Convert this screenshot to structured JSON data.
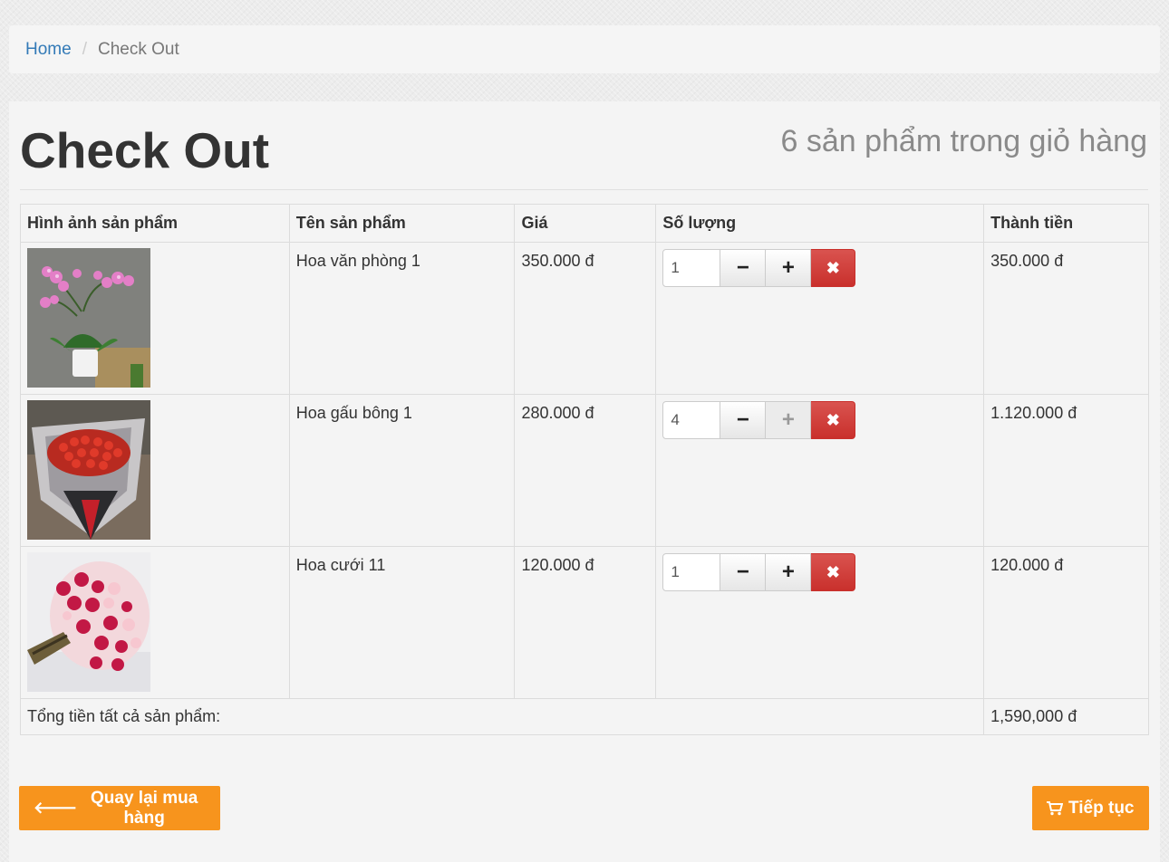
{
  "breadcrumb": {
    "home": "Home",
    "separator": "/",
    "current": "Check Out"
  },
  "page": {
    "title": "Check Out",
    "cart_count": "6 sản phẩm trong giỏ hàng"
  },
  "table": {
    "headers": [
      "Hình ảnh sản phẩm",
      "Tên sản phẩm",
      "Giá",
      "Số lượng",
      "Thành tiền"
    ],
    "rows": [
      {
        "name": "Hoa văn phòng 1",
        "price": "350.000 đ",
        "qty": "1",
        "subtotal": "350.000 đ",
        "image": "orchid-photo",
        "minus_disabled": false,
        "plus_disabled": false
      },
      {
        "name": "Hoa gấu bông 1",
        "price": "280.000 đ",
        "qty": "4",
        "subtotal": "1.120.000 đ",
        "image": "red-rose-bouquet-photo",
        "minus_disabled": false,
        "plus_disabled": true
      },
      {
        "name": "Hoa cưới 11",
        "price": "120.000 đ",
        "qty": "1",
        "subtotal": "120.000 đ",
        "image": "pink-rose-bouquet-photo",
        "minus_disabled": false,
        "plus_disabled": false
      }
    ],
    "total_label": "Tổng tiền tất cả sản phẩm:",
    "total_value": "1,590,000 đ"
  },
  "icons": {
    "minus": "minus-icon",
    "plus": "plus-icon",
    "remove": "remove-icon",
    "back": "arrow-left-icon",
    "cart": "cart-icon"
  },
  "buttons": {
    "back": "Quay lại mua hàng",
    "next": "Tiếp tục"
  },
  "colors": {
    "accent": "#f7941d",
    "danger": "#d9534f",
    "link": "#337ab7"
  }
}
